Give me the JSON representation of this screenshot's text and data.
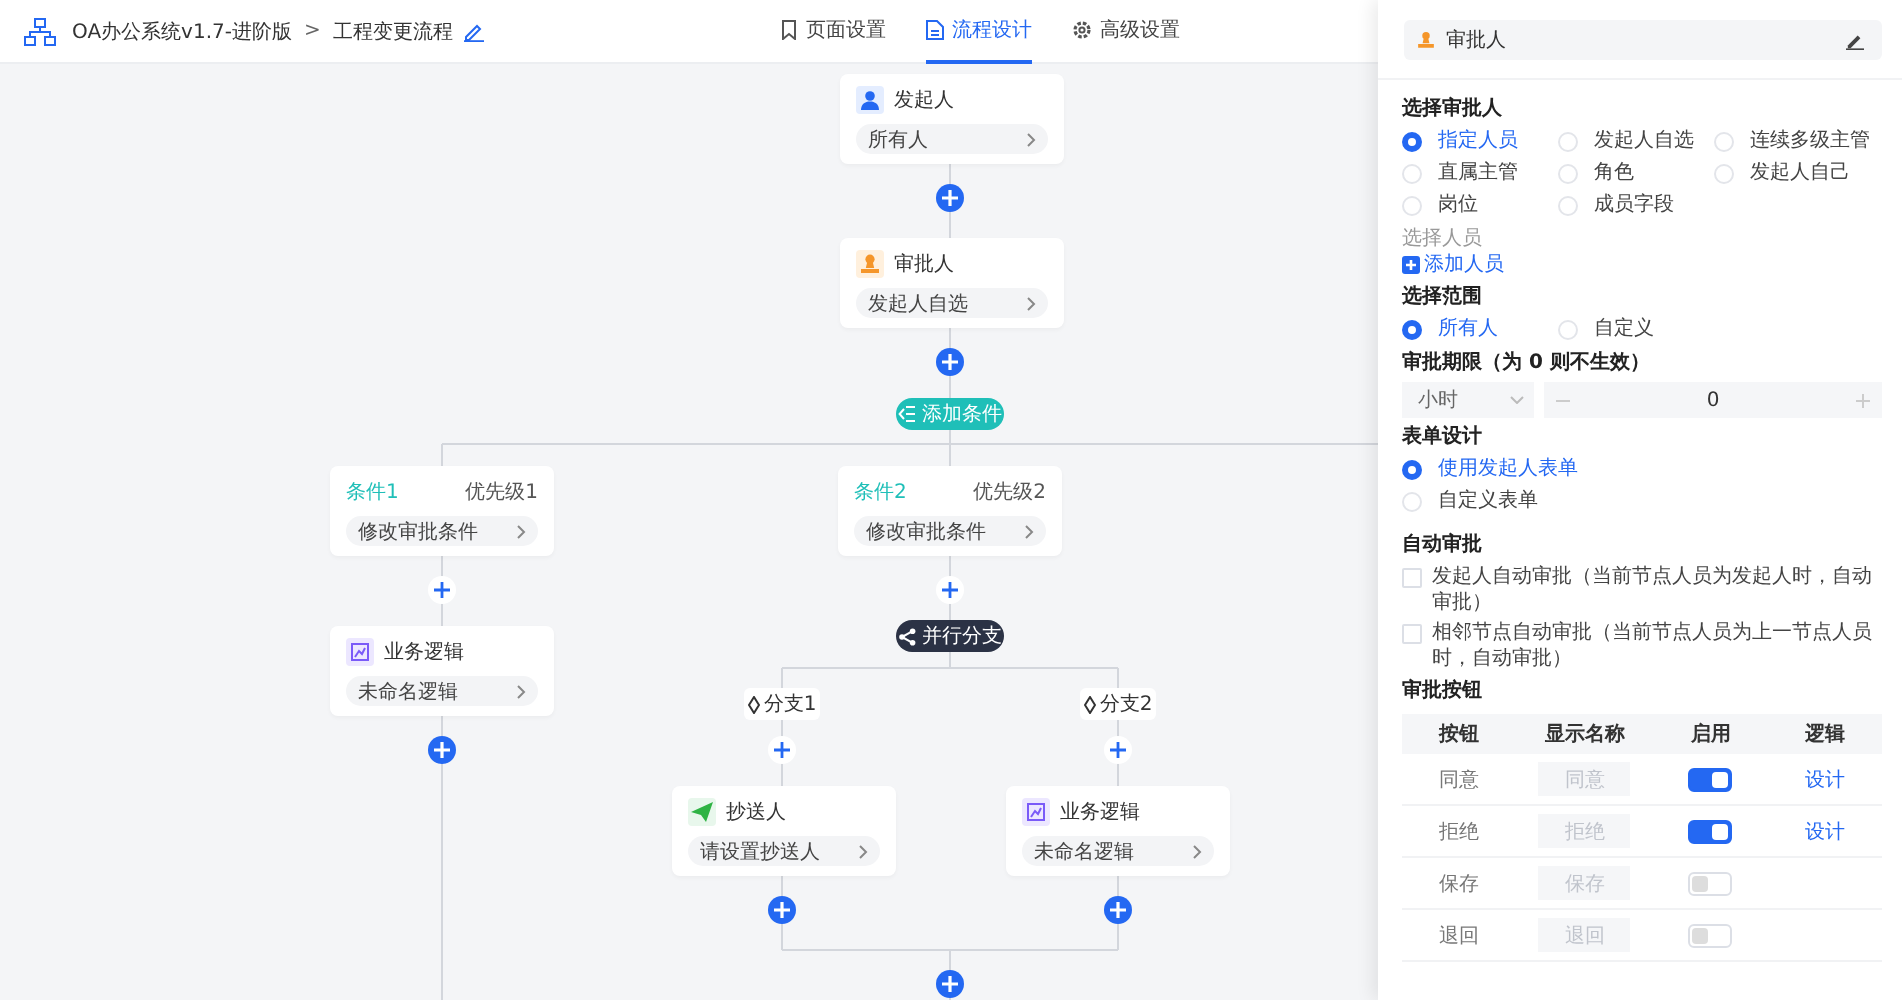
{
  "header": {
    "project": "OA办公系统v1.7-进阶版",
    "separator": ">",
    "page": "工程变更流程"
  },
  "tabs": [
    {
      "label": "页面设置",
      "kind": "bookmark",
      "selected": false
    },
    {
      "label": "流程设计",
      "kind": "document",
      "selected": true
    },
    {
      "label": "高级设置",
      "kind": "gear",
      "selected": false
    }
  ],
  "flow": {
    "nodes": [
      {
        "kind": "starter",
        "title": "发起人",
        "summary": "所有人"
      },
      {
        "kind": "approver",
        "title": "审批人",
        "summary": "发起人自选"
      }
    ],
    "add_condition": "添加条件",
    "conditions": [
      {
        "title": "条件1",
        "priority": "优先级1",
        "summary": "修改审批条件",
        "nodes": [
          {
            "kind": "logic",
            "title": "业务逻辑",
            "summary": "未命名逻辑"
          }
        ]
      },
      {
        "title": "条件2",
        "priority": "优先级2",
        "summary": "修改审批条件",
        "parallel": {
          "label": "并行分支",
          "branches": [
            {
              "label": "分支1",
              "nodes": [
                {
                  "kind": "cc",
                  "title": "抄送人",
                  "summary": "请设置抄送人"
                }
              ]
            },
            {
              "label": "分支2",
              "nodes": [
                {
                  "kind": "logic",
                  "title": "业务逻辑",
                  "summary": "未命名逻辑"
                }
              ]
            }
          ]
        }
      }
    ]
  },
  "panel": {
    "node": {
      "title": "审批人"
    },
    "approver_type": {
      "label": "选择审批人",
      "options": [
        {
          "label": "指定人员",
          "selected": true
        },
        {
          "label": "发起人自选",
          "selected": false
        },
        {
          "label": "连续多级主管",
          "selected": false
        },
        {
          "label": "直属主管",
          "selected": false
        },
        {
          "label": "角色",
          "selected": false
        },
        {
          "label": "发起人自己",
          "selected": false
        },
        {
          "label": "岗位",
          "selected": false
        },
        {
          "label": "成员字段",
          "selected": false
        }
      ]
    },
    "member": {
      "label": "选择人员",
      "add": "添加人员"
    },
    "scope": {
      "label": "选择范围",
      "options": [
        {
          "label": "所有人",
          "selected": true
        },
        {
          "label": "自定义",
          "selected": false
        }
      ]
    },
    "deadline": {
      "label": "审批期限（为 0 则不生效）",
      "unit": "小时",
      "value": "0"
    },
    "form": {
      "label": "表单设计",
      "options": [
        {
          "label": "使用发起人表单",
          "selected": true
        },
        {
          "label": "自定义表单",
          "selected": false
        }
      ]
    },
    "auto": {
      "label": "自动审批",
      "options": [
        {
          "label": "发起人自动审批（当前节点人员为发起人时，自动审批）",
          "checked": false
        },
        {
          "label": "相邻节点自动审批（当前节点人员为上一节点人员时，自动审批）",
          "checked": false
        }
      ]
    },
    "buttons": {
      "label": "审批按钮",
      "columns": [
        "按钮",
        "显示名称",
        "启用",
        "逻辑"
      ],
      "rows": [
        {
          "name": "同意",
          "display": "同意",
          "on": true,
          "logic": "设计"
        },
        {
          "name": "拒绝",
          "display": "拒绝",
          "on": true,
          "logic": "设计"
        },
        {
          "name": "保存",
          "display": "保存",
          "on": false
        },
        {
          "name": "退回",
          "display": "退回",
          "on": false
        }
      ]
    }
  }
}
